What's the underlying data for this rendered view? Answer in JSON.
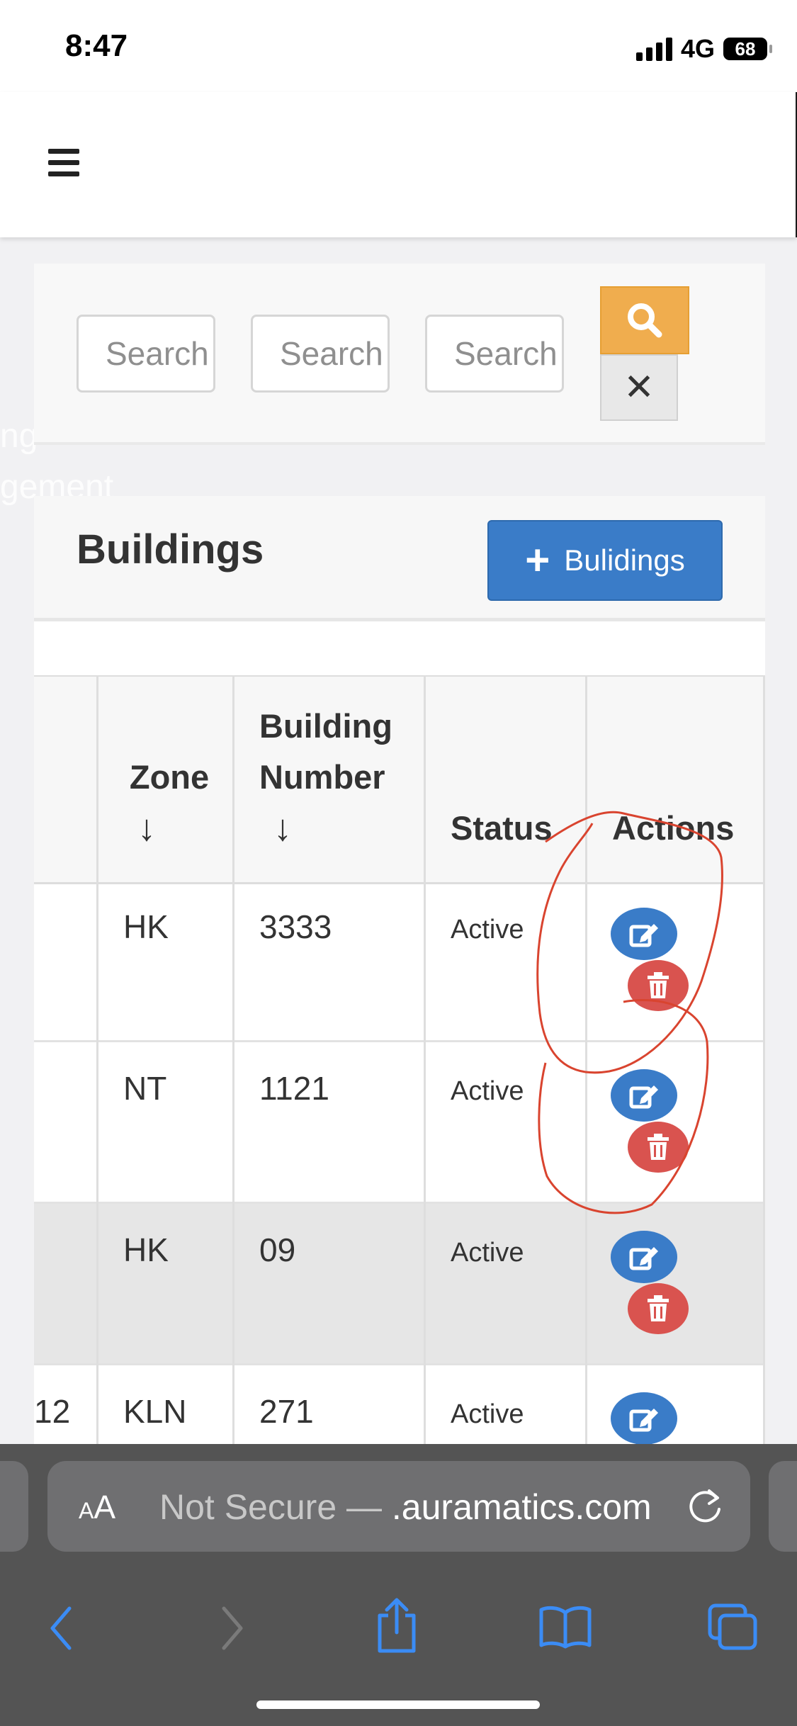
{
  "status_bar": {
    "time": "8:47",
    "network": "4G",
    "battery": "68"
  },
  "search": {
    "placeholder_1": "Search",
    "placeholder_2": "Search",
    "placeholder_3": "Search",
    "clear_label": "✕"
  },
  "background_text": {
    "line1": "ng",
    "line2": "gement"
  },
  "buildings": {
    "title": "Buildings",
    "add_button_label": "Bulidings"
  },
  "table": {
    "headers": {
      "zone": "Zone",
      "building_number_line1": "Building",
      "building_number_line2": "Number",
      "status": "Status",
      "actions": "Actions"
    },
    "sort_indicator": "↓",
    "rows": [
      {
        "first_col": "",
        "zone": "HK",
        "building_number": "3333",
        "status": "Active"
      },
      {
        "first_col": "",
        "zone": "NT",
        "building_number": "1121",
        "status": "Active"
      },
      {
        "first_col": "",
        "zone": "HK",
        "building_number": "09",
        "status": "Active"
      },
      {
        "first_col": "12",
        "zone": "KLN",
        "building_number": "271",
        "status": "Active"
      }
    ]
  },
  "browser": {
    "text_size_label": "A",
    "text_size_label_big": "A",
    "url_prefix": "Not Secure — ",
    "url_domain": ".auramatics.com"
  },
  "colors": {
    "primary": "#3a7cc8",
    "warning": "#f0ad4e",
    "danger": "#d9534f",
    "annotation": "#d9442f"
  }
}
